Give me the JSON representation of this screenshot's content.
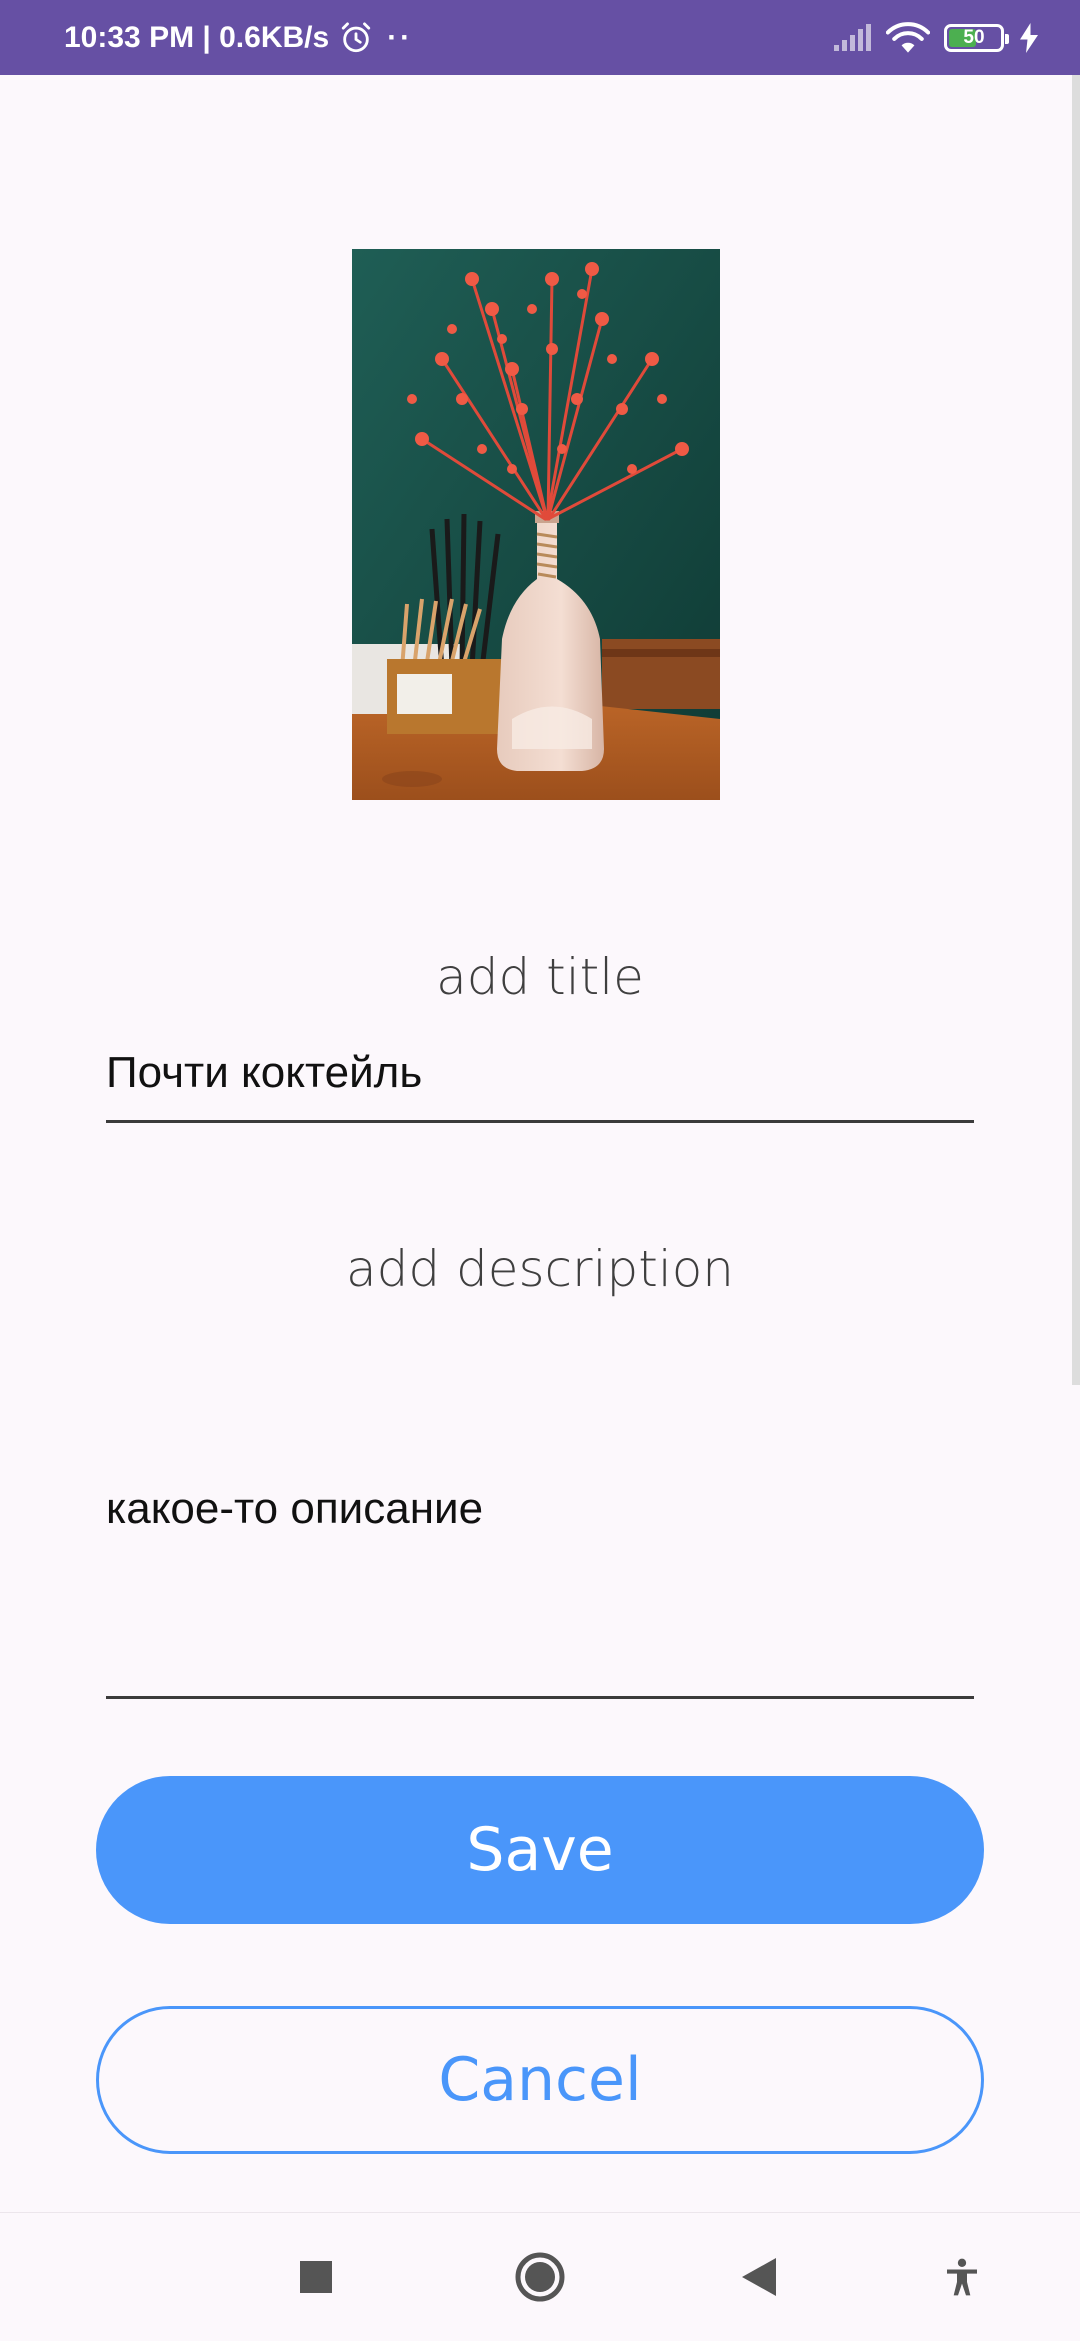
{
  "status_bar": {
    "time_speed": "10:33 PM | 0.6KB/s",
    "dots": "··",
    "battery_level": "50",
    "icons": [
      "alarm-icon",
      "signal-icon",
      "wifi-icon",
      "battery-icon",
      "charging-icon"
    ]
  },
  "form": {
    "title_label": "add title",
    "title_value": "Почти коктейль",
    "description_label": "add description",
    "description_value": "какое-то описание"
  },
  "buttons": {
    "save_label": "Save",
    "cancel_label": "Cancel"
  },
  "nav": {
    "icons": [
      "recents-icon",
      "home-icon",
      "back-icon",
      "accessibility-icon"
    ]
  },
  "colors": {
    "status_bar": "#6650A4",
    "accent": "#4A96FA",
    "background": "#FCF8FC"
  }
}
